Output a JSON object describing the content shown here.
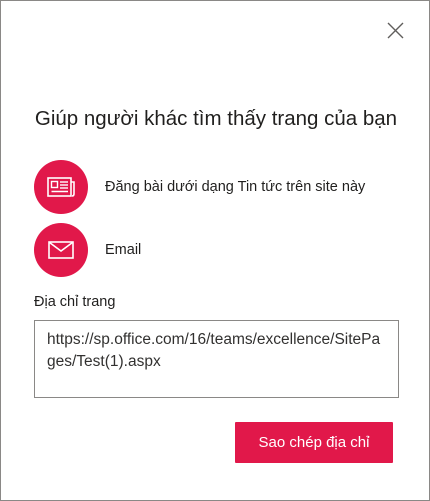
{
  "dialog": {
    "title": "Giúp người khác tìm thấy trang của bạn",
    "close_icon": "close-icon"
  },
  "options": [
    {
      "label": "Đăng bài dưới dạng Tin tức trên site này",
      "icon": "news-icon"
    },
    {
      "label": "Email",
      "icon": "mail-icon"
    }
  ],
  "address": {
    "label": "Địa chỉ trang",
    "value": "https://sp.office.com/16/teams/excellence/SitePages/Test(1).aspx"
  },
  "copy_button": {
    "label": "Sao chép địa chỉ"
  },
  "colors": {
    "accent": "#e1184a",
    "border": "#8a8886"
  }
}
